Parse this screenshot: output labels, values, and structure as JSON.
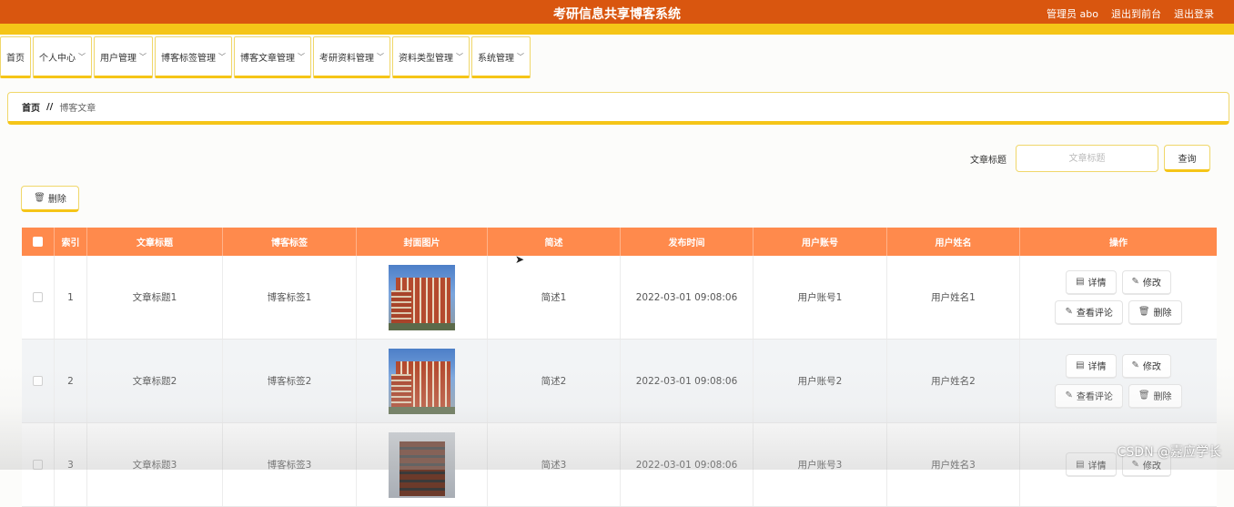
{
  "app": {
    "title": "考研信息共享博客系统",
    "user_label": "管理员 abo",
    "back_front": "退出到前台",
    "logout": "退出登录"
  },
  "nav": {
    "items": [
      {
        "label": "首页",
        "has_dropdown": false
      },
      {
        "label": "个人中心",
        "has_dropdown": true
      },
      {
        "label": "用户管理",
        "has_dropdown": true
      },
      {
        "label": "博客标签管理",
        "has_dropdown": true
      },
      {
        "label": "博客文章管理",
        "has_dropdown": true
      },
      {
        "label": "考研资料管理",
        "has_dropdown": true
      },
      {
        "label": "资料类型管理",
        "has_dropdown": true
      },
      {
        "label": "系统管理",
        "has_dropdown": true
      }
    ]
  },
  "breadcrumb": {
    "home": "首页",
    "separator": "//",
    "current": "博客文章"
  },
  "search": {
    "label": "文章标题",
    "placeholder": "文章标题",
    "button": "查询"
  },
  "toolbar": {
    "delete_label": "删除"
  },
  "table": {
    "headers": [
      "索引",
      "文章标题",
      "博客标签",
      "封面图片",
      "简述",
      "发布时间",
      "用户账号",
      "用户姓名",
      "操作"
    ],
    "rows": [
      {
        "index": "1",
        "title": "文章标题1",
        "tag": "博客标签1",
        "summary": "简述1",
        "time": "2022-03-01 09:08:06",
        "account": "用户账号1",
        "name": "用户姓名1"
      },
      {
        "index": "2",
        "title": "文章标题2",
        "tag": "博客标签2",
        "summary": "简述2",
        "time": "2022-03-01 09:08:06",
        "account": "用户账号2",
        "name": "用户姓名2"
      },
      {
        "index": "3",
        "title": "文章标题3",
        "tag": "博客标签3",
        "summary": "简述3",
        "time": "2022-03-01 09:08:06",
        "account": "用户账号3",
        "name": "用户姓名3"
      }
    ],
    "actions": {
      "detail": "详情",
      "edit": "修改",
      "comments": "查看评论",
      "delete": "删除"
    }
  },
  "watermark": "CSDN @嘉应学长",
  "colors": {
    "header": "#d9560f",
    "accent": "#f5c517",
    "table_header": "#ff8a4c"
  }
}
